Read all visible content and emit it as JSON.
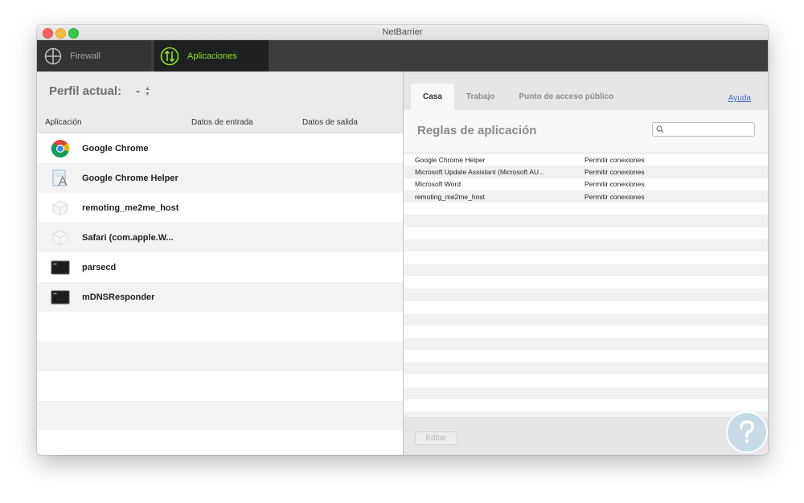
{
  "window": {
    "title": "NetBarrier"
  },
  "toolbar": {
    "firewall_label": "Firewall",
    "apps_label": "Aplicaciones",
    "accent": "#8fe02e"
  },
  "profile": {
    "label": "Perfil actual:",
    "value": "-"
  },
  "app_list": {
    "columns": [
      "Aplicación",
      "Datos de entrada",
      "Datos de salida"
    ],
    "items": [
      {
        "name": "Google Chrome",
        "icon": "chrome-icon"
      },
      {
        "name": "Google Chrome Helper",
        "icon": "app-generic-icon"
      },
      {
        "name": "remoting_me2me_host",
        "icon": "app-blank-icon"
      },
      {
        "name": "Safari (com.apple.W...",
        "icon": "app-blank-icon"
      },
      {
        "name": "parsecd",
        "icon": "terminal-icon"
      },
      {
        "name": "mDNSResponder",
        "icon": "terminal-icon"
      }
    ]
  },
  "rules_panel": {
    "tabs": [
      "Casa",
      "Trabajo",
      "Punto de acceso público"
    ],
    "active_tab": "Casa",
    "help_label": "Ayuda",
    "title": "Reglas de aplicación",
    "search_placeholder": "",
    "rules": [
      {
        "app": "Google Chrome Helper",
        "action": "Permitir conexiones"
      },
      {
        "app": "Microsoft Update Assistant (Microsoft AU...",
        "action": "Permitir conexiones"
      },
      {
        "app": "Microsoft Word",
        "action": "Permitir conexiones"
      },
      {
        "app": "remoting_me2me_host",
        "action": "Permitir conexiones"
      }
    ],
    "edit_label": "Editar"
  }
}
